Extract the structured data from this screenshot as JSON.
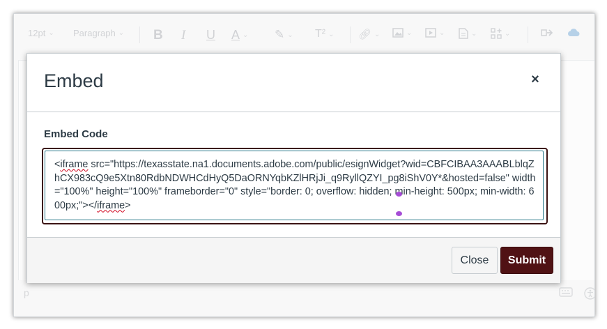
{
  "toolbar": {
    "font_size": "12pt",
    "block_format": "Paragraph",
    "bold_icon": "B",
    "italic_icon": "I",
    "underline_icon": "U",
    "font_color_icon": "A",
    "superscript_icon": "T²"
  },
  "statusbar": {
    "path": "p"
  },
  "modal": {
    "title": "Embed",
    "close_glyph": "×",
    "field_label": "Embed Code",
    "code_part1": "<",
    "code_word1": "iframe",
    "code_part2": " src=\"https://texasstate.na1.documents.adobe.com/public/esignWidget?wid=CBFCIBAA3AAABLblqZhCX983cQ9e5Xtn80RdbNDWHCdHyQ5DaORNYqbKZlHRjJi_q9RyllQZYI_pg8iShV0Y*&hosted=false\" width=\"100%\" height=\"100%\" frameborder=\"0\" style=\"border: 0; overflow: hidden; min-height: 500px; min-width: 600px;\"></",
    "code_word2": "iframe",
    "code_part3": ">",
    "close_button": "Close",
    "submit_button": "Submit"
  },
  "colors": {
    "submit_bg": "#501214",
    "focus_ring": "#3b1414",
    "inner_border": "#2c7a8c",
    "text": "#2d3b45"
  }
}
